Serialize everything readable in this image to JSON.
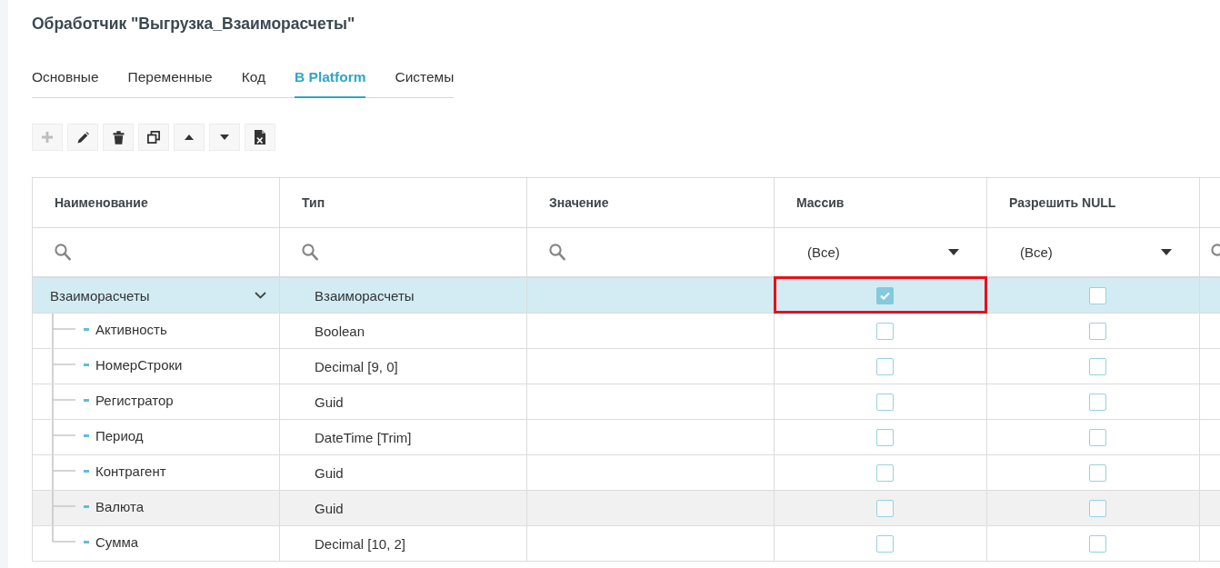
{
  "title": "Обработчик \"Выгрузка_Взаиморасчеты\"",
  "tabs": [
    {
      "label": "Основные",
      "selected": false
    },
    {
      "label": "Переменные",
      "selected": false
    },
    {
      "label": "Код",
      "selected": false
    },
    {
      "label": "В Platform",
      "selected": true
    },
    {
      "label": "Системы",
      "selected": false
    }
  ],
  "toolbar": [
    {
      "kind": "add",
      "disabled": true
    },
    {
      "kind": "edit",
      "disabled": false
    },
    {
      "kind": "delete",
      "disabled": false
    },
    {
      "kind": "copy",
      "disabled": false
    },
    {
      "kind": "move_up",
      "disabled": false
    },
    {
      "kind": "move_down",
      "disabled": false
    },
    {
      "kind": "export_excel",
      "disabled": false
    }
  ],
  "table": {
    "columns": [
      {
        "label": "Наименование",
        "filter": {
          "kind": "search"
        }
      },
      {
        "label": "Тип",
        "filter": {
          "kind": "search"
        }
      },
      {
        "label": "Значение",
        "filter": {
          "kind": "search"
        }
      },
      {
        "label": "Массив",
        "filter": {
          "kind": "select",
          "value": "(Все)"
        }
      },
      {
        "label": "Разрешить NULL",
        "filter": {
          "kind": "select",
          "value": "(Все)"
        }
      },
      {
        "filter": {
          "kind": "search"
        }
      }
    ],
    "rows": [
      {
        "name": "Взаиморасчеты",
        "type": "Взаиморасчеты",
        "array": {
          "checked": true,
          "outlined": true
        },
        "allow_null": {
          "checked": false,
          "outlined": false
        },
        "selected": true,
        "hovered": false,
        "expanded": true,
        "children": [
          {
            "name": "Активность",
            "type": "Boolean",
            "array": {
              "checked": false,
              "outlined": false
            },
            "allow_null": {
              "checked": false,
              "outlined": false
            },
            "selected": false,
            "hovered": false
          },
          {
            "name": "НомерСтроки",
            "type": "Decimal [9, 0]",
            "array": {
              "checked": false,
              "outlined": false
            },
            "allow_null": {
              "checked": false,
              "outlined": false
            },
            "selected": false,
            "hovered": false
          },
          {
            "name": "Регистратор",
            "type": "Guid",
            "array": {
              "checked": false,
              "outlined": false
            },
            "allow_null": {
              "checked": false,
              "outlined": false
            },
            "selected": false,
            "hovered": false
          },
          {
            "name": "Период",
            "type": "DateTime [Trim]",
            "array": {
              "checked": false,
              "outlined": false
            },
            "allow_null": {
              "checked": false,
              "outlined": false
            },
            "selected": false,
            "hovered": false
          },
          {
            "name": "Контрагент",
            "type": "Guid",
            "array": {
              "checked": false,
              "outlined": false
            },
            "allow_null": {
              "checked": false,
              "outlined": false
            },
            "selected": false,
            "hovered": false
          },
          {
            "name": "Валюта",
            "type": "Guid",
            "array": {
              "checked": false,
              "outlined": false
            },
            "allow_null": {
              "checked": false,
              "outlined": false
            },
            "selected": false,
            "hovered": true
          },
          {
            "name": "Сумма",
            "type": "Decimal [10, 2]",
            "array": {
              "checked": false,
              "outlined": false
            },
            "allow_null": {
              "checked": false,
              "outlined": false
            },
            "selected": false,
            "hovered": false
          }
        ]
      }
    ]
  }
}
